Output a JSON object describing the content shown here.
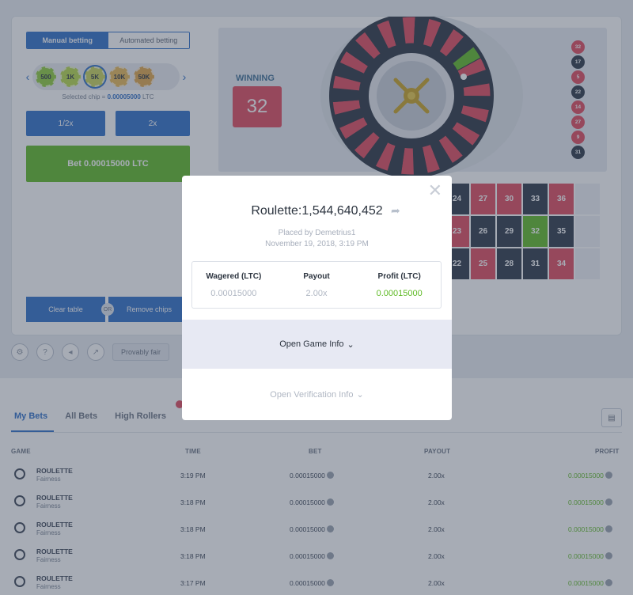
{
  "sidebar": {
    "tabs": [
      "Manual betting",
      "Automated betting"
    ],
    "chips": [
      {
        "label": "500",
        "color": "#8fcc3d"
      },
      {
        "label": "1K",
        "color": "#b7d94c"
      },
      {
        "label": "5K",
        "color": "#c9d45a"
      },
      {
        "label": "10K",
        "color": "#e8b957"
      },
      {
        "label": "50K",
        "color": "#e0a64a"
      }
    ],
    "selected_chip_prefix": "Selected chip = ",
    "selected_chip_value": "0.00005000",
    "selected_chip_unit": " LTC",
    "half_label": "1/2x",
    "double_label": "2x",
    "bet_label": "Bet 0.00015000 LTC",
    "clear_label": "Clear table",
    "or_label": "OR",
    "remove_label": "Remove chips"
  },
  "winning": {
    "label": "WINNING",
    "number": "32"
  },
  "history": [
    {
      "n": "32",
      "c": "red"
    },
    {
      "n": "17",
      "c": "black"
    },
    {
      "n": "5",
      "c": "red"
    },
    {
      "n": "22",
      "c": "black"
    },
    {
      "n": "14",
      "c": "red"
    },
    {
      "n": "27",
      "c": "red"
    },
    {
      "n": "9",
      "c": "red"
    },
    {
      "n": "31",
      "c": "black"
    }
  ],
  "board": [
    [
      "24",
      "27",
      "30",
      "33",
      "36",
      ""
    ],
    [
      "23",
      "26",
      "29",
      "32",
      "35",
      ""
    ],
    [
      "22",
      "25",
      "28",
      "31",
      "34",
      ""
    ]
  ],
  "footer": {
    "fair_label": "Provably fair"
  },
  "bets": {
    "tabs": [
      "My Bets",
      "All Bets",
      "High Rollers"
    ],
    "headers": {
      "game": "GAME",
      "time": "TIME",
      "bet": "BET",
      "payout": "PAYOUT",
      "profit": "PROFIT"
    },
    "rows": [
      {
        "game": "ROULETTE",
        "sub": "Fairness",
        "time": "3:19 PM",
        "bet": "0.00015000",
        "payout": "2.00x",
        "profit": "0.00015000"
      },
      {
        "game": "ROULETTE",
        "sub": "Fairness",
        "time": "3:18 PM",
        "bet": "0.00015000",
        "payout": "2.00x",
        "profit": "0.00015000"
      },
      {
        "game": "ROULETTE",
        "sub": "Fairness",
        "time": "3:18 PM",
        "bet": "0.00015000",
        "payout": "2.00x",
        "profit": "0.00015000"
      },
      {
        "game": "ROULETTE",
        "sub": "Fairness",
        "time": "3:18 PM",
        "bet": "0.00015000",
        "payout": "2.00x",
        "profit": "0.00015000"
      },
      {
        "game": "ROULETTE",
        "sub": "Fairness",
        "time": "3:17 PM",
        "bet": "0.00015000",
        "payout": "2.00x",
        "profit": "0.00015000"
      }
    ]
  },
  "modal": {
    "title": "Roulette:1,544,640,452",
    "placed_by": "Placed by Demetrius1",
    "date": "November 19, 2018, 3:19 PM",
    "wagered_label": "Wagered (LTC)",
    "wagered_value": "0.00015000",
    "payout_label": "Payout",
    "payout_value": "2.00x",
    "profit_label": "Profit (LTC)",
    "profit_value": "0.00015000",
    "game_info_label": "Open Game Info",
    "verification_label": "Open Verification Info"
  },
  "colors": {
    "accent": "#2f6fc8",
    "green": "#5fba25",
    "red": "#e04a5e",
    "black": "#2d3848"
  }
}
